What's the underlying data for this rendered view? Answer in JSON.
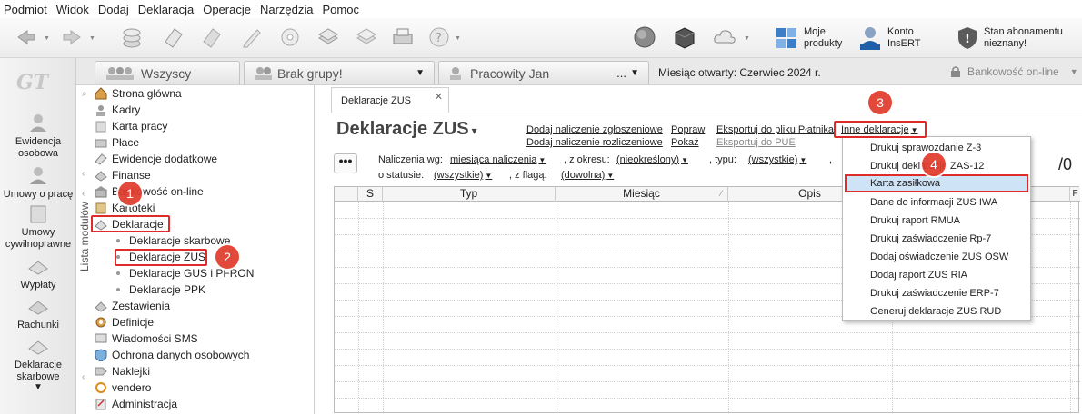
{
  "menu": [
    "Podmiot",
    "Widok",
    "Dodaj",
    "Deklaracja",
    "Operacje",
    "Narzędzia",
    "Pomoc"
  ],
  "toolbar": {
    "moje_produkty": "Moje\nprodukty",
    "konto": "Konto\nInsERT",
    "stan": "Stan abonamentu\nnieznany!"
  },
  "sidebar_strip": {
    "logo": "GT",
    "items": [
      "Ewidencja osobowa",
      "Umowy o pracę",
      "Umowy cywilnoprawne",
      "Wypłaty",
      "Rachunki",
      "Deklaracje skarbowe"
    ]
  },
  "top_tabs": {
    "all": "Wszyscy",
    "no_group": "Brak grupy!",
    "employee": "Pracowity Jan",
    "employee_more": "...",
    "period": "Miesiąc otwarty: Czerwiec 2024 r.",
    "bank": "Bankowość on-line"
  },
  "modules": {
    "vertical_label": "Lista modułów",
    "items": [
      "Strona główna",
      "Kadry",
      "Karta pracy",
      "Płace",
      "Ewidencje dodatkowe",
      "Finanse",
      "Bankowość on-line",
      "Kartoteki",
      "Deklaracje"
    ],
    "sub_items": [
      "Deklaracje skarbowe",
      "Deklaracje ZUS",
      "Deklaracje GUS i PFRON",
      "Deklaracje PPK"
    ],
    "items_after": [
      "Zestawienia",
      "Definicje",
      "Wiadomości SMS",
      "Ochrona danych osobowych",
      "Naklejki",
      "vendero",
      "Administracja"
    ]
  },
  "content": {
    "tab_label": "Deklaracje ZUS",
    "title": "Deklaracje ZUS",
    "actions": {
      "add_zgloszeniowe": "Dodaj naliczenie zgłoszeniowe",
      "add_rozliczeniowe": "Dodaj naliczenie rozliczeniowe",
      "popraw": "Popraw",
      "pokaz": "Pokaż",
      "eksport_platnik": "Eksportuj do pliku Płatnika",
      "eksport_pue": "Eksportuj do PUE",
      "inne": "Inne deklaracje"
    },
    "filters": {
      "naliczenia_label": "Naliczenia wg:",
      "naliczenia_val": "miesiąca naliczenia",
      "okres_label": ", z okresu:",
      "okres_val": "(nieokreślony)",
      "typ_label": ", typu:",
      "typ_val": "(wszystkie)",
      "comma": ",",
      "status_label": "o statusie:",
      "status_val": "(wszystkie)",
      "flaga_label": ", z flagą:",
      "flaga_val": "(dowolna)",
      "more": "•••"
    },
    "count": "/0",
    "columns": [
      "S",
      "Typ",
      "Miesiąc",
      "Opis",
      "F"
    ]
  },
  "dropdown": {
    "items": [
      "Drukuj sprawozdanie Z-3",
      "Drukuj deklarację ZAS-12",
      "Karta zasiłkowa",
      "Dane do informacji ZUS IWA",
      "Drukuj raport RMUA",
      "Drukuj zaświadczenie Rp-7",
      "Dodaj oświadczenie ZUS OSW",
      "Dodaj raport ZUS RIA",
      "Drukuj zaświadczenie ERP-7",
      "Generuj deklaracje ZUS RUD"
    ]
  },
  "annotations": {
    "badges": [
      "1",
      "2",
      "3",
      "4"
    ],
    "color": "#e02b2b"
  }
}
